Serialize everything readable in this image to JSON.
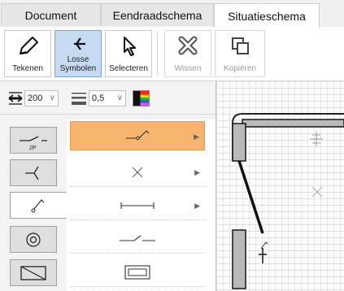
{
  "tabs": [
    {
      "label": "Document",
      "active": false
    },
    {
      "label": "Eendraadschema",
      "active": false
    },
    {
      "label": "Situatieschema",
      "active": true
    }
  ],
  "ribbon": {
    "buttons": [
      {
        "label": "Tekenen",
        "icon": "pencil-icon",
        "active": false
      },
      {
        "label": "Losse Symbolen",
        "icon": "loose-symbol-icon",
        "active": true
      },
      {
        "label": "Selecteren",
        "icon": "cursor-icon",
        "active": false
      },
      {
        "label": "Wissen",
        "icon": "erase-icon",
        "active": false,
        "disabled": true
      },
      {
        "label": "Kopiëren",
        "icon": "copy-icon",
        "active": false,
        "disabled": true
      }
    ]
  },
  "toolbar": {
    "size_value": "200",
    "line_width_value": "0,5",
    "size_icon": "size-icon",
    "line_width_icon": "line-width-icon",
    "color_icon": "color-palette-icon"
  },
  "symbol_categories": [
    {
      "name": "switch-2p",
      "label": "2P",
      "active": false
    },
    {
      "name": "socket",
      "active": false
    },
    {
      "name": "switch-single",
      "active": true
    },
    {
      "name": "outlet-circle",
      "active": false
    },
    {
      "name": "rectangle-box",
      "active": false
    }
  ],
  "symbol_items": [
    {
      "name": "switch-symbol",
      "selected": true,
      "has_submenu": true
    },
    {
      "name": "cross-symbol",
      "selected": false,
      "has_submenu": true
    },
    {
      "name": "line-symbol",
      "selected": false,
      "has_submenu": true
    },
    {
      "name": "broken-line-symbol",
      "selected": false,
      "has_submenu": false
    },
    {
      "name": "box-symbol",
      "selected": false,
      "has_submenu": false
    }
  ],
  "colors": {
    "accent_selected": "#f8b46e",
    "ribbon_active": "#c6daf2",
    "wall_fill": "#b9b9b9"
  }
}
